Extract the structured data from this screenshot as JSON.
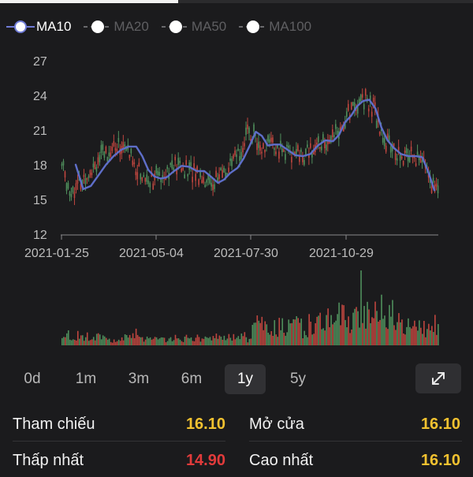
{
  "legend": [
    {
      "label": "MA10",
      "active": true,
      "color": "#6f7bd6"
    },
    {
      "label": "MA20",
      "active": false
    },
    {
      "label": "MA50",
      "active": false
    },
    {
      "label": "MA100",
      "active": false
    }
  ],
  "chart_data": {
    "type": "candlestick",
    "yticks": [
      27,
      24,
      21,
      18,
      15,
      12
    ],
    "ylim": [
      12,
      28
    ],
    "xticks": [
      "2021-01-25",
      "2021-05-04",
      "2021-07-30",
      "2021-10-29"
    ],
    "colors": {
      "up": "#4f8f5c",
      "down": "#c0463f",
      "ma": "#5e6ec9"
    },
    "ma10": [
      [
        0,
        18.6
      ],
      [
        10,
        16.3
      ],
      [
        20,
        16.6
      ],
      [
        30,
        17.6
      ],
      [
        40,
        18.6
      ],
      [
        50,
        19.4
      ],
      [
        60,
        20.0
      ],
      [
        70,
        20.3
      ],
      [
        80,
        20.3
      ],
      [
        88,
        19.4
      ],
      [
        96,
        18.1
      ],
      [
        104,
        17.5
      ],
      [
        112,
        17.3
      ],
      [
        120,
        17.4
      ],
      [
        130,
        18.0
      ],
      [
        140,
        18.5
      ],
      [
        150,
        18.4
      ],
      [
        160,
        18.0
      ],
      [
        170,
        18.0
      ],
      [
        180,
        17.4
      ],
      [
        188,
        16.9
      ],
      [
        196,
        17.2
      ],
      [
        204,
        17.8
      ],
      [
        214,
        18.3
      ],
      [
        222,
        19.2
      ],
      [
        230,
        20.4
      ],
      [
        238,
        21.7
      ],
      [
        246,
        21.3
      ],
      [
        254,
        20.4
      ],
      [
        262,
        20.5
      ],
      [
        270,
        20.5
      ],
      [
        280,
        20.0
      ],
      [
        290,
        19.5
      ],
      [
        300,
        19.4
      ],
      [
        310,
        19.6
      ],
      [
        320,
        20.4
      ],
      [
        330,
        20.9
      ],
      [
        340,
        20.8
      ],
      [
        348,
        21.4
      ],
      [
        356,
        22.6
      ],
      [
        364,
        23.2
      ],
      [
        372,
        24.1
      ],
      [
        380,
        24.6
      ],
      [
        388,
        24.7
      ],
      [
        396,
        23.9
      ],
      [
        404,
        22.1
      ],
      [
        412,
        20.9
      ],
      [
        420,
        20.2
      ],
      [
        430,
        19.6
      ],
      [
        440,
        19.4
      ],
      [
        450,
        19.4
      ],
      [
        458,
        19.3
      ],
      [
        466,
        17.9
      ],
      [
        474,
        16.2
      ]
    ]
  },
  "ranges": [
    {
      "label": "0d",
      "selected": false
    },
    {
      "label": "1m",
      "selected": false
    },
    {
      "label": "3m",
      "selected": false
    },
    {
      "label": "6m",
      "selected": false
    },
    {
      "label": "1y",
      "selected": true
    },
    {
      "label": "5y",
      "selected": false
    }
  ],
  "stats": {
    "tham_chieu": {
      "label": "Tham chiếu",
      "value": "16.10",
      "color": "#f2c230"
    },
    "mo_cua": {
      "label": "Mở cửa",
      "value": "16.10",
      "color": "#f2c230"
    },
    "thap_nhat": {
      "label": "Thấp nhất",
      "value": "14.90",
      "color": "#e23b3b"
    },
    "cao_nhat": {
      "label": "Cao nhất",
      "value": "16.10",
      "color": "#f2c230"
    }
  }
}
